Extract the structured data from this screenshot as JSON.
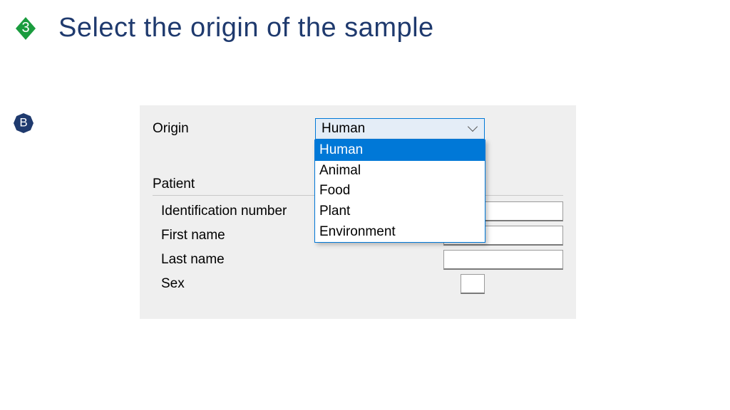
{
  "step": {
    "number": "3",
    "title": "Select the origin of the sample",
    "sub_letter": "B"
  },
  "form": {
    "origin_label": "Origin",
    "origin_value": "Human",
    "origin_options": [
      "Human",
      "Animal",
      "Food",
      "Plant",
      "Environment"
    ],
    "patient_section": "Patient",
    "fields": {
      "id_label": "Identification number",
      "first_name_label": "First name",
      "last_name_label": "Last name",
      "sex_label": "Sex"
    }
  },
  "colors": {
    "title": "#1f3a6e",
    "badge_green": "#1a9c3e",
    "badge_blue": "#1f3a6e",
    "select_highlight": "#0078d7"
  }
}
